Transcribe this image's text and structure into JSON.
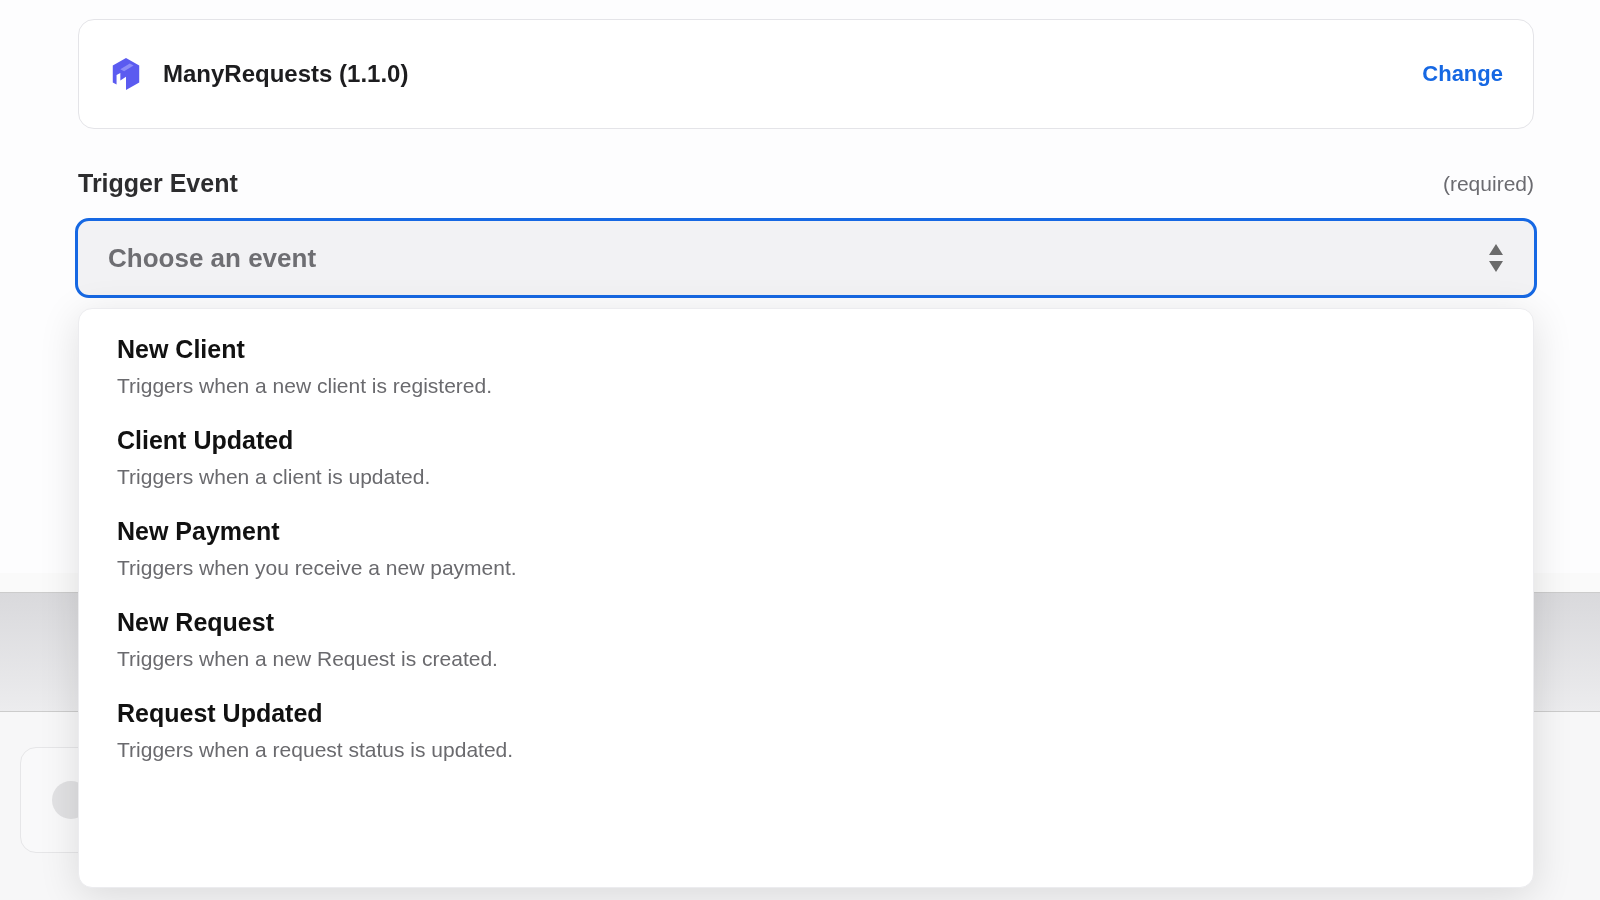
{
  "app_card": {
    "name": "ManyRequests (1.1.0)",
    "change_link": "Change"
  },
  "trigger_event": {
    "label": "Trigger Event",
    "required_note": "(required)",
    "placeholder": "Choose an event",
    "expanded": true,
    "options": [
      {
        "title": "New Client",
        "description": "Triggers when a new client is registered."
      },
      {
        "title": "Client Updated",
        "description": "Triggers when a client is updated."
      },
      {
        "title": "New Payment",
        "description": "Triggers when you receive a new payment."
      },
      {
        "title": "New Request",
        "description": "Triggers when a new Request is created."
      },
      {
        "title": "Request Updated",
        "description": "Triggers when a request status is updated."
      }
    ]
  }
}
